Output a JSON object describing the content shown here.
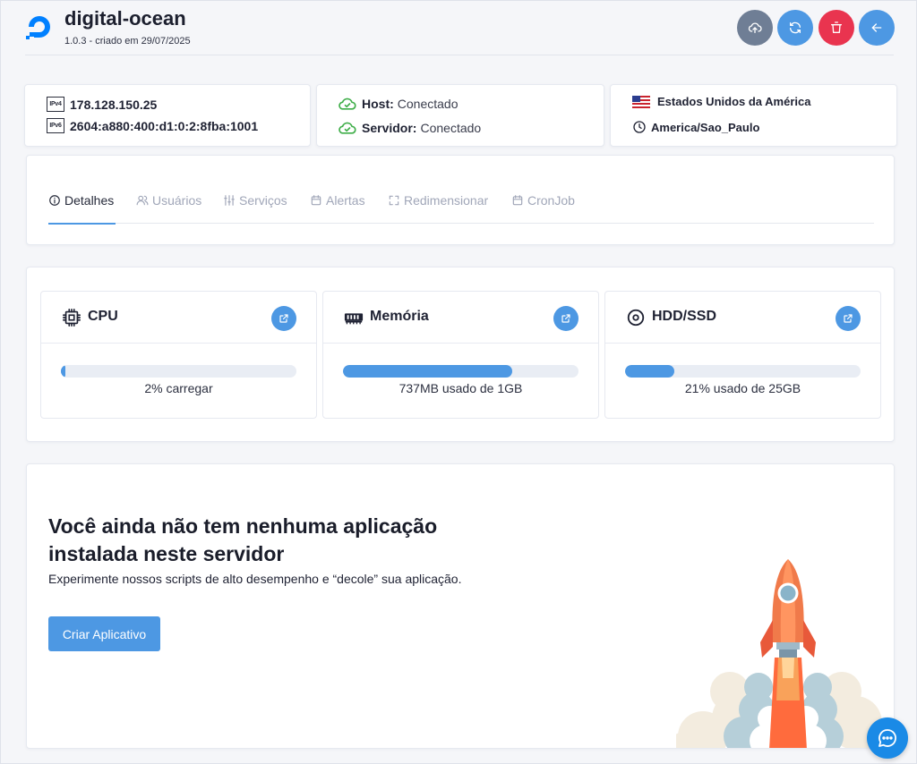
{
  "header": {
    "title": "digital-ocean",
    "subtitle": "1.0.3 - criado em 29/07/2025"
  },
  "network": {
    "ipv4_badge": "IPv4",
    "ipv4": "178.128.150.25",
    "ipv6_badge": "IPv6",
    "ipv6": "2604:a880:400:d1:0:2:8fba:1001"
  },
  "status": {
    "host_label": "Host:",
    "host_value": "Conectado",
    "server_label": "Servidor:",
    "server_value": "Conectado",
    "ok_color": "#3fae49"
  },
  "location": {
    "country": "Estados Unidos da América",
    "timezone": "America/Sao_Paulo"
  },
  "tabs": [
    {
      "label": "Detalhes",
      "icon": "info-icon",
      "active": true
    },
    {
      "label": "Usuários",
      "icon": "users-icon",
      "active": false
    },
    {
      "label": "Serviços",
      "icon": "sliders-icon",
      "active": false
    },
    {
      "label": "Alertas",
      "icon": "calendar-icon",
      "active": false
    },
    {
      "label": "Redimensionar",
      "icon": "resize-icon",
      "active": false
    },
    {
      "label": "CronJob",
      "icon": "calendar-icon",
      "active": false
    }
  ],
  "metrics": {
    "cpu": {
      "title": "CPU",
      "caption": "2% carregar",
      "percent": 2
    },
    "memory": {
      "title": "Memória",
      "caption": "737MB usado de 1GB",
      "percent": 72
    },
    "disk": {
      "title": "HDD/SSD",
      "caption": "21% usado de 25GB",
      "percent": 21
    }
  },
  "empty_state": {
    "title": "Você ainda não tem nenhuma aplicação instalada neste servidor",
    "subtitle": "Experimente nossos scripts de alto desempenho e “decole” sua aplicação.",
    "button": "Criar Aplicativo"
  },
  "colors": {
    "primary": "#4d98e3",
    "danger": "#e9344f",
    "secondary": "#6f7e95"
  }
}
